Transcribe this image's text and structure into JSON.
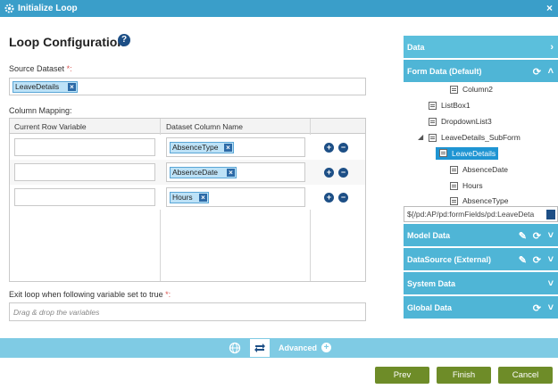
{
  "window": {
    "title": "Initialize Loop",
    "close_glyph": "×"
  },
  "heading": "Loop Configuration",
  "source_dataset": {
    "label": "Source Dataset",
    "required_mark": "*:",
    "value": "LeaveDetails"
  },
  "column_mapping": {
    "label": "Column Mapping:",
    "headers": [
      "Current Row Variable",
      "Dataset Column Name"
    ],
    "rows": [
      {
        "variable": "",
        "column": "AbsenceType"
      },
      {
        "variable": "",
        "column": "AbsenceDate"
      },
      {
        "variable": "",
        "column": "Hours"
      }
    ]
  },
  "exit_loop": {
    "label": "Exit loop when following variable set to true",
    "required_mark": "*:",
    "placeholder": "Drag & drop the variables"
  },
  "footer": {
    "advanced_label": "Advanced"
  },
  "buttons": {
    "prev": "Prev",
    "finish": "Finish",
    "cancel": "Cancel"
  },
  "data_panel": {
    "title": "Data",
    "form_data_title": "Form Data (Default)",
    "tree": [
      {
        "label": "Column2",
        "level": 3
      },
      {
        "label": "ListBox1",
        "level": 2
      },
      {
        "label": "DropdownList3",
        "level": 2
      },
      {
        "label": "LeaveDetails_SubForm",
        "level": 2,
        "expanded": true
      },
      {
        "label": "LeaveDetails",
        "level": 3,
        "selected": true
      },
      {
        "label": "AbsenceDate",
        "level": 4
      },
      {
        "label": "Hours",
        "level": 4
      },
      {
        "label": "AbsenceType",
        "level": 4
      }
    ],
    "path_value": "${/pd:AP/pd:formFields/pd:LeaveDeta",
    "sections": [
      {
        "title": "Model Data",
        "edit": true,
        "refresh": true
      },
      {
        "title": "DataSource (External)",
        "edit": true,
        "refresh": true
      },
      {
        "title": "System Data",
        "edit": false,
        "refresh": false
      },
      {
        "title": "Global Data",
        "edit": false,
        "refresh": true
      }
    ]
  },
  "colors": {
    "title_bar": "#3a9ec9",
    "panel_header": "#5bbfdc",
    "panel_section": "#4fb5d6",
    "footer_bar": "#7fcbe4",
    "button_green": "#6e8c28",
    "tag_fill": "#bde2f7",
    "required": "#d9534f"
  }
}
